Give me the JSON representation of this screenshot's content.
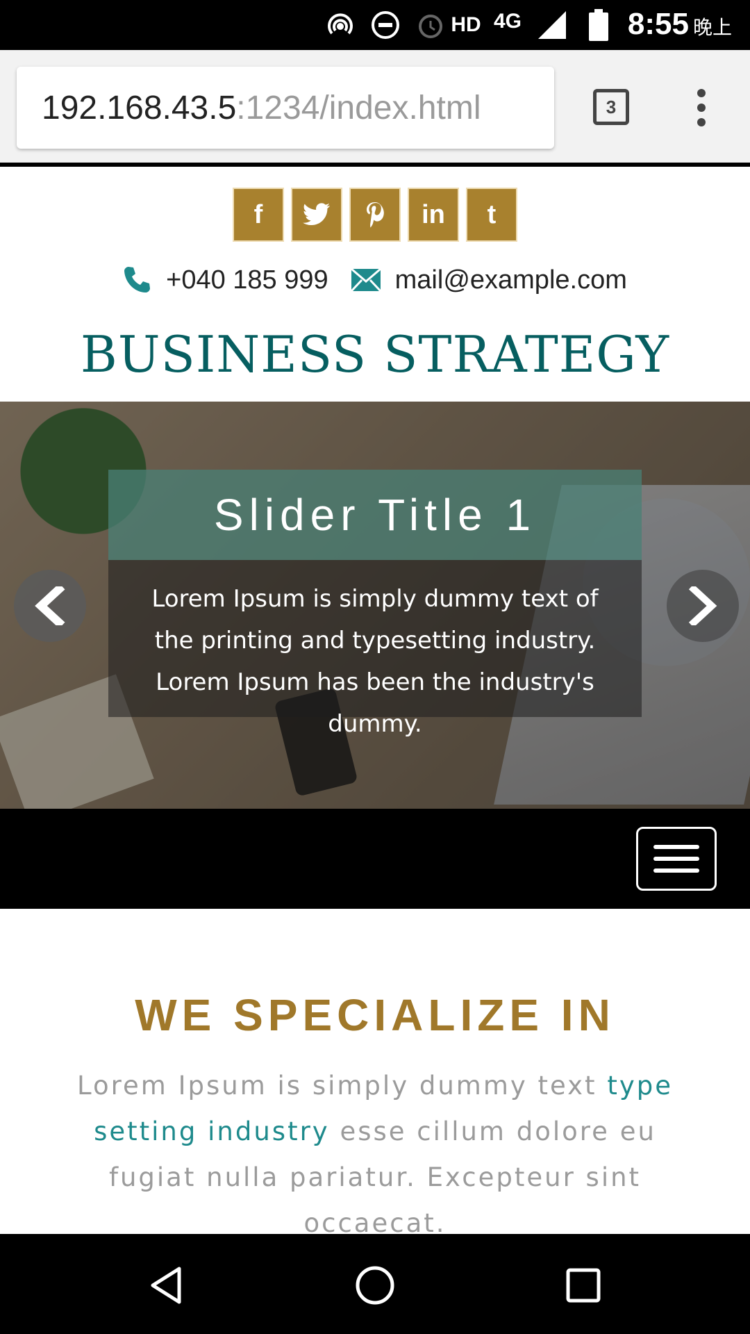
{
  "status_bar": {
    "network": "HD",
    "signal_type": "4G",
    "time": "8:55",
    "time_suffix": "晚上",
    "icons": [
      "hotspot-icon",
      "do-not-disturb-icon",
      "alarm-icon",
      "signal-icon",
      "battery-icon"
    ]
  },
  "browser": {
    "url_host": "192.168.43.5",
    "url_path": ":1234/index.html",
    "tab_count": "3"
  },
  "social": [
    {
      "name": "facebook",
      "glyph": "f"
    },
    {
      "name": "twitter",
      "glyph": "t"
    },
    {
      "name": "pinterest",
      "glyph": "P"
    },
    {
      "name": "linkedin",
      "glyph": "in"
    },
    {
      "name": "tumblr",
      "glyph": "t"
    }
  ],
  "contact": {
    "phone": "+040 185 999",
    "email": "mail@example.com"
  },
  "brand": {
    "title": "BUSINESS STRATEGY"
  },
  "slider": {
    "title": "Slider Title 1",
    "text": "Lorem Ipsum is simply dummy text of the printing and typesetting industry. Lorem Ipsum has been the industry's dummy."
  },
  "section": {
    "title": "WE SPECIALIZE IN",
    "text_before": "Lorem Ipsum is simply dummy text ",
    "text_link": "type setting industry",
    "text_after": " esse cillum dolore eu fugiat nulla pariatur. Excepteur sint occaecat."
  },
  "colors": {
    "gold": "#a8812e",
    "teal": "#065e60",
    "link_teal": "#1e8a8c",
    "heading_gold": "#a0782a"
  }
}
